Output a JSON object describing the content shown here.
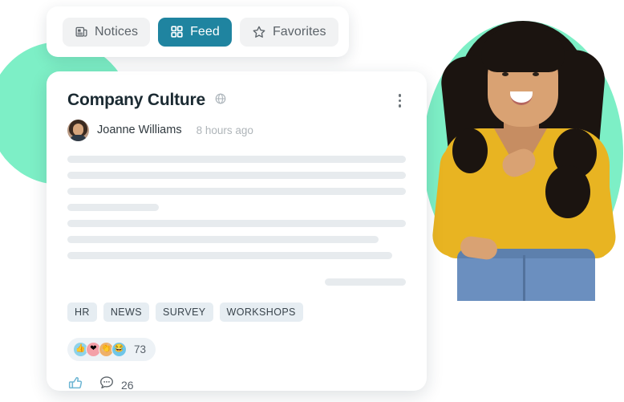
{
  "theme": {
    "accent_teal": "#1F84A0",
    "mint_blob": "#7DEFC6",
    "card_bg": "#FFFFFF",
    "skeleton_gray": "#E7EBEE",
    "tag_bg": "#E6EDF2",
    "sweater_yellow": "#E8B422"
  },
  "tabbar": {
    "tabs": [
      {
        "label": "Notices",
        "icon": "newspaper-icon",
        "active": false
      },
      {
        "label": "Feed",
        "icon": "grid-icon",
        "active": true
      },
      {
        "label": "Favorites",
        "icon": "star-icon",
        "active": false
      }
    ]
  },
  "post": {
    "title": "Company Culture",
    "visibility_icon": "globe-icon",
    "menu_icon": "kebab-menu-icon",
    "author": "Joanne Williams",
    "timestamp": "8 hours ago",
    "avatar_alt": "Joanne Williams avatar",
    "body_skeleton": {
      "lines": [
        {
          "width": "100%"
        },
        {
          "width": "100%"
        },
        {
          "width": "100%"
        },
        {
          "width": "27%"
        },
        {
          "width": "100%"
        },
        {
          "width": "92%"
        },
        {
          "width": "96%"
        }
      ],
      "trailing_line": {
        "width": "24%"
      }
    },
    "tags": [
      "HR",
      "NEWS",
      "SURVEY",
      "WORKSHOPS"
    ],
    "reactions": {
      "emojis": [
        {
          "name": "thumbs-up-reaction",
          "glyph": "👍"
        },
        {
          "name": "heart-reaction",
          "glyph": "❤"
        },
        {
          "name": "clap-reaction",
          "glyph": "👏"
        },
        {
          "name": "laugh-reaction",
          "glyph": "😂"
        }
      ],
      "count": "73"
    },
    "actions": {
      "like_icon": "thumbs-up-icon",
      "comment_icon": "comment-bubble-icon",
      "comment_count": "26"
    }
  },
  "illustration": {
    "person_alt": "Smiling woman in yellow sweater pointing"
  }
}
